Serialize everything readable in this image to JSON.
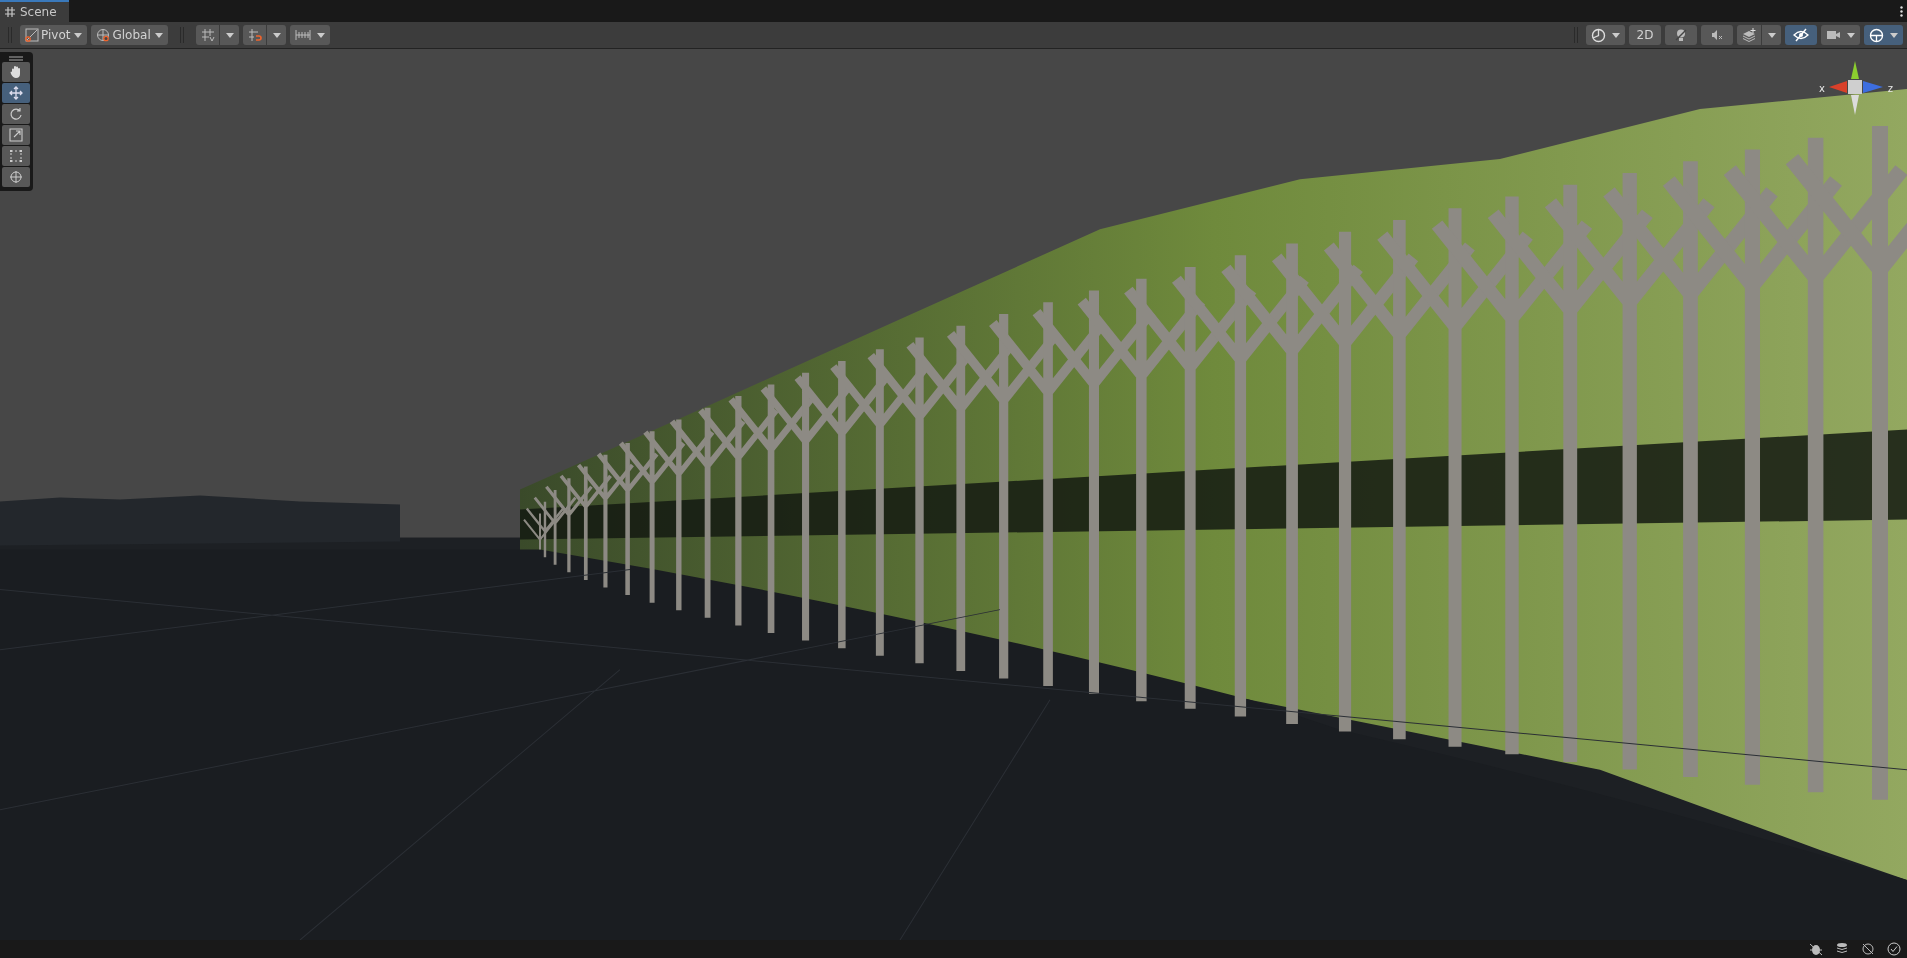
{
  "tab": {
    "label": "Scene",
    "selected": true
  },
  "toolbar": {
    "pivot": "Pivot",
    "space": "Global",
    "two_d": {
      "label": "2D",
      "selected": false
    },
    "lighting": {
      "selected": false
    },
    "audio": {
      "selected": false
    },
    "scene_visibility": {
      "selected": true
    },
    "gizmos": {
      "selected": true
    }
  },
  "tools": [
    {
      "kind": "hand",
      "selected": false
    },
    {
      "kind": "move",
      "selected": true
    },
    {
      "kind": "rotate",
      "selected": false
    },
    {
      "kind": "scale",
      "selected": false
    },
    {
      "kind": "rect",
      "selected": false
    },
    {
      "kind": "transform",
      "selected": false
    }
  ],
  "gizmo": {
    "x_label": "x",
    "z_label": "z"
  }
}
